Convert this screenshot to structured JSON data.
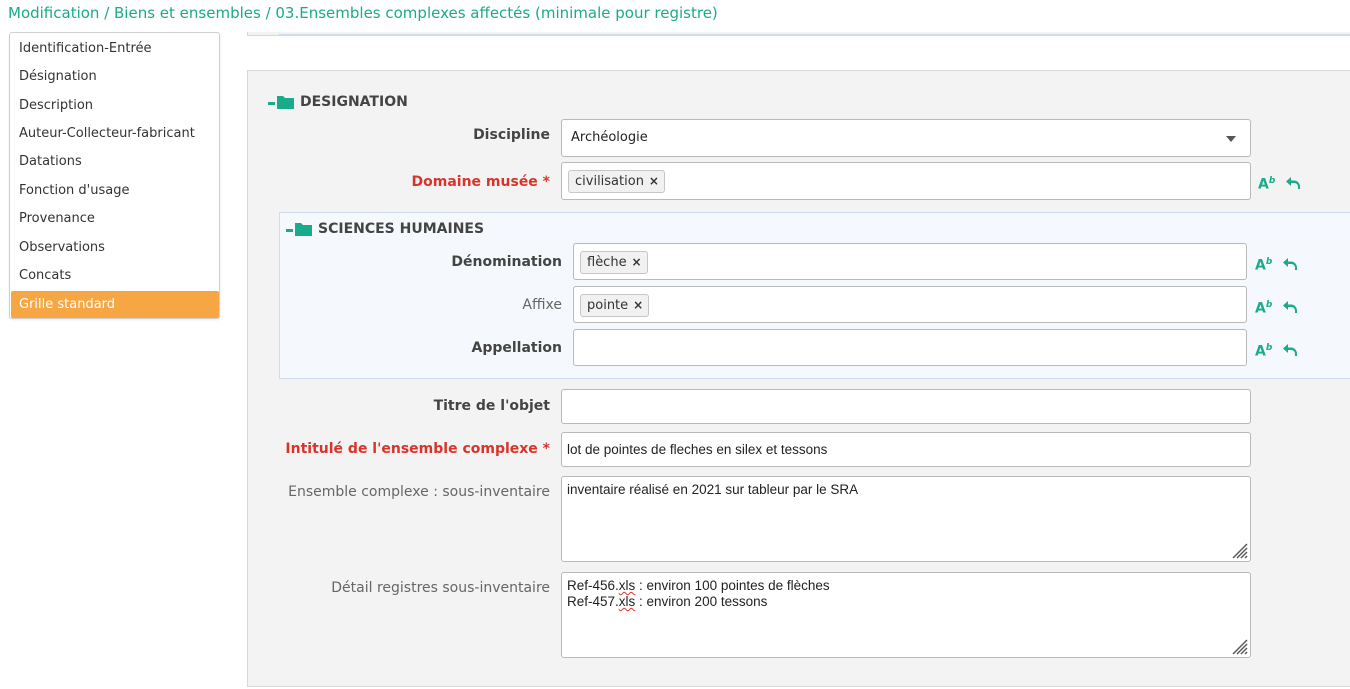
{
  "breadcrumb": "Modification / Biens et ensembles / 03.Ensembles complexes affectés (minimale pour registre)",
  "menu": {
    "items": [
      {
        "label": "Identification-Entrée"
      },
      {
        "label": "Désignation"
      },
      {
        "label": "Description"
      },
      {
        "label": "Auteur-Collecteur-fabricant"
      },
      {
        "label": "Datations"
      },
      {
        "label": "Fonction d'usage"
      },
      {
        "label": "Provenance"
      },
      {
        "label": "Observations"
      },
      {
        "label": "Concats"
      },
      {
        "label": "Grille standard",
        "active": true
      }
    ]
  },
  "designation": {
    "title": "DESIGNATION",
    "discipline": {
      "label": "Discipline",
      "value": "Archéologie"
    },
    "domaine": {
      "label": "Domaine musée *",
      "tag": "civilisation"
    },
    "sciences": {
      "title": "SCIENCES HUMAINES",
      "denomination": {
        "label": "Dénomination",
        "tag": "flèche"
      },
      "affixe": {
        "label": "Affixe",
        "tag": "pointe"
      },
      "appellation": {
        "label": "Appellation",
        "value": ""
      }
    },
    "titre": {
      "label": "Titre de l'objet",
      "value": ""
    },
    "intitule": {
      "label": "Intitulé de l'ensemble complexe *",
      "value": "lot de pointes de fleches en silex et tessons"
    },
    "sous_inventaire": {
      "label": "Ensemble complexe : sous-inventaire",
      "value": "inventaire réalisé en 2021 sur tableur par le SRA"
    },
    "detail": {
      "label": "Détail registres sous-inventaire",
      "line1_prefix": "Ref-456.",
      "line1_ext": "xls",
      "line1_rest": " : environ 100 pointes de flèches",
      "line2_prefix": "Ref-457.",
      "line2_ext": "xls",
      "line2_rest": " : environ 200 tessons"
    }
  },
  "icons": {
    "format": "A",
    "format_sup": "b",
    "accent_color": "#1aab8a",
    "active_menu_color": "#f7a644",
    "required_color": "#d9342b"
  }
}
